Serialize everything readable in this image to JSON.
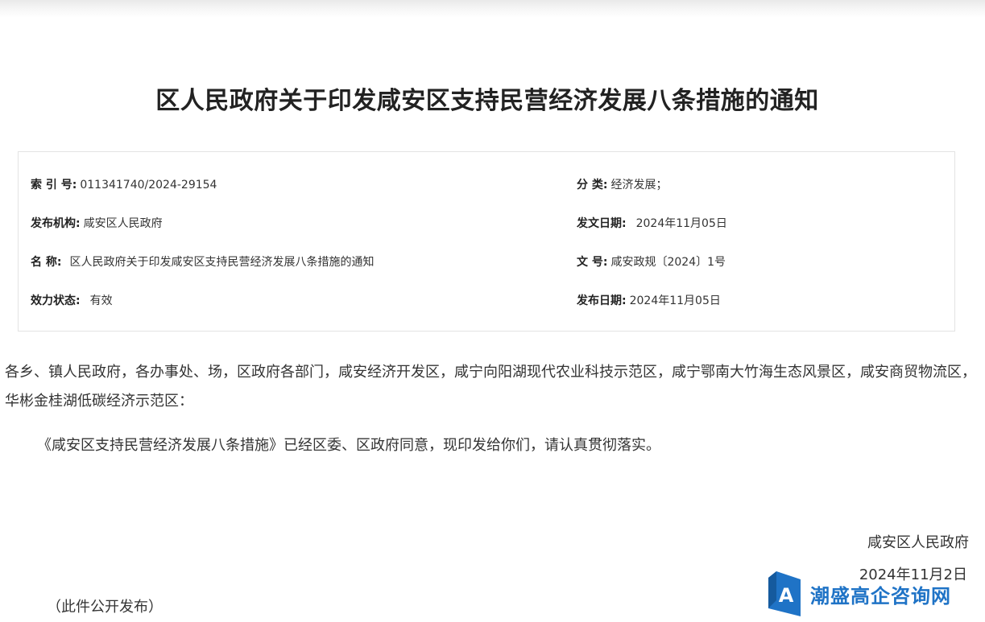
{
  "document": {
    "title": "区人民政府关于印发咸安区支持民营经济发展八条措施的通知",
    "meta": {
      "index_no": {
        "label": "索 引 号:",
        "value": "011341740/2024-29154"
      },
      "category": {
        "label": "分 类:",
        "value": "经济发展；"
      },
      "publisher": {
        "label": "发布机构:",
        "value": "咸安区人民政府"
      },
      "issue_date": {
        "label": "发文日期:",
        "value": "2024年11月05日"
      },
      "name": {
        "label": "名 称:",
        "value": "区人民政府关于印发咸安区支持民营经济发展八条措施的通知"
      },
      "doc_no": {
        "label": "文 号:",
        "value": "咸安政规〔2024〕1号"
      },
      "status": {
        "label": "效力状态:",
        "value": "有效"
      },
      "publish_date": {
        "label": "发布日期:",
        "value": "2024年11月05日"
      }
    },
    "addressee": "各乡、镇人民政府，各办事处、场，区政府各部门，咸安经济开发区，咸宁向阳湖现代农业科技示范区，咸宁鄂南大竹海生态风景区，咸安商贸物流区，华彬金桂湖低碳经济示范区：",
    "body": "《咸安区支持民营经济发展八条措施》已经区委、区政府同意，现印发给你们，请认真贯彻落实。",
    "signature_org": "咸安区人民政府",
    "signature_date": "2024年11月2日",
    "public_note": "（此件公开发布）"
  },
  "watermark": {
    "text": "潮盛高企咨询网",
    "logo_letter": "A",
    "color": "#1f73c6"
  }
}
